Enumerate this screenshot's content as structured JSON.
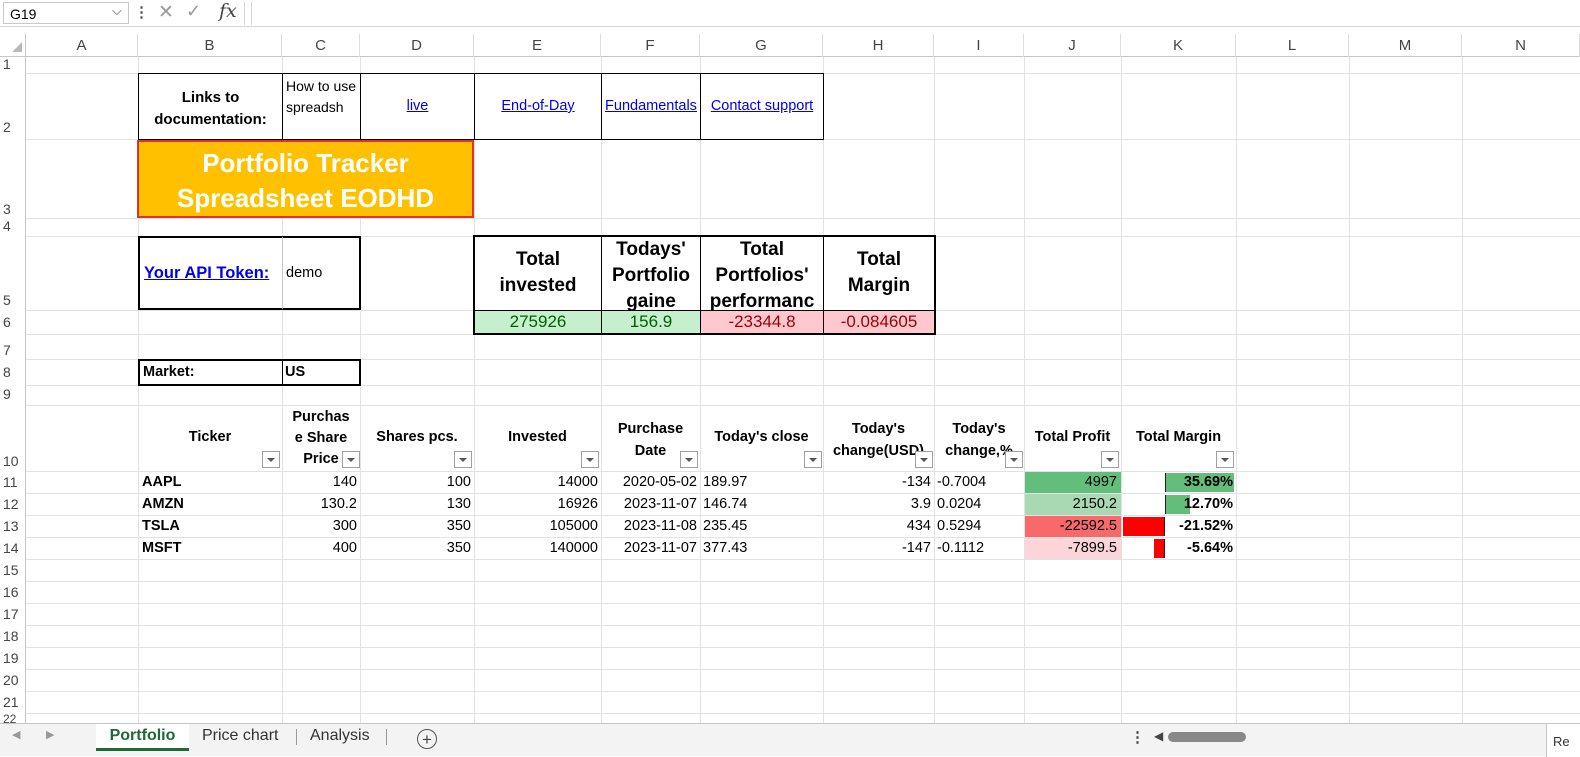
{
  "formula_bar": {
    "name_box": "G19",
    "formula": ""
  },
  "columns": [
    "A",
    "B",
    "C",
    "D",
    "E",
    "F",
    "G",
    "H",
    "I",
    "J",
    "K",
    "L",
    "M",
    "N"
  ],
  "rows": [
    "1",
    "2",
    "3",
    "4",
    "5",
    "6",
    "7",
    "8",
    "9",
    "10",
    "11",
    "12",
    "13",
    "14",
    "15",
    "16",
    "17",
    "18",
    "19",
    "20",
    "21",
    "22"
  ],
  "links_label": "Links to documentation:",
  "links": {
    "how_to": "How to use spreadsh",
    "live": "live",
    "eod": "End-of-Day",
    "fundamentals": "Fundamentals",
    "contact": "Contact support"
  },
  "title": "Portfolio Tracker Spreadsheet EODHD",
  "api": {
    "label": "Your API Token:",
    "value": "demo"
  },
  "market": {
    "label": "Market:",
    "value": "US"
  },
  "summary": {
    "headers": [
      "Total invested",
      "Todays' Portfolio gaine",
      "Total Portfolios' performanc",
      "Total Margin"
    ],
    "values": [
      "275926",
      "156.9",
      "-23344.8",
      "-0.084605"
    ]
  },
  "table": {
    "headers": {
      "ticker": "Ticker",
      "price": "Purchas e Share Price",
      "shares": "Shares pcs.",
      "invested": "Invested",
      "date": "Purchase Date",
      "close": "Today's close",
      "chg_usd": "Today's change(USD)",
      "chg_pct": "Today's change,%",
      "profit": "Total Profit",
      "margin": "Total Margin"
    },
    "rows": [
      {
        "ticker": "AAPL",
        "price": "140",
        "shares": "100",
        "invested": "14000",
        "date": "2020-05-02",
        "close": "189.97",
        "chg_usd": "-134",
        "chg_pct": "-0.7004",
        "profit": "4997",
        "margin": "35.69%",
        "margin_value": 0.3569
      },
      {
        "ticker": "AMZN",
        "price": "130.2",
        "shares": "130",
        "invested": "16926",
        "date": "2023-11-07",
        "close": "146.74",
        "chg_usd": "3.9",
        "chg_pct": "0.0204",
        "profit": "2150.2",
        "margin": "12.70%",
        "margin_value": 0.127
      },
      {
        "ticker": "TSLA",
        "price": "300",
        "shares": "350",
        "invested": "105000",
        "date": "2023-11-08",
        "close": "235.45",
        "chg_usd": "434",
        "chg_pct": "0.5294",
        "profit": "-22592.5",
        "margin": "-21.52%",
        "margin_value": -0.2152
      },
      {
        "ticker": "MSFT",
        "price": "400",
        "shares": "350",
        "invested": "140000",
        "date": "2023-11-07",
        "close": "377.43",
        "chg_usd": "-147",
        "chg_pct": "-0.1112",
        "profit": "-7899.5",
        "margin": "-5.64%",
        "margin_value": -0.0564
      }
    ]
  },
  "colors": {
    "title_bg": "#ffc000",
    "title_border": "#e03030",
    "positive_fill": "#c6efce",
    "positive_text": "#006100",
    "negative_fill": "#ffc7ce",
    "negative_text": "#9c0006",
    "profit_strong_green": "#63be7b",
    "profit_light_green": "#a9d9b3",
    "profit_strong_red": "#f8696b",
    "profit_light_red": "#fbd5d8",
    "bar_green": "#63be7b",
    "bar_red": "#ff0000"
  },
  "sheet_tabs": [
    "Portfolio",
    "Price chart",
    "Analysis"
  ],
  "active_tab": "Portfolio",
  "status": {
    "ready": "Re"
  }
}
